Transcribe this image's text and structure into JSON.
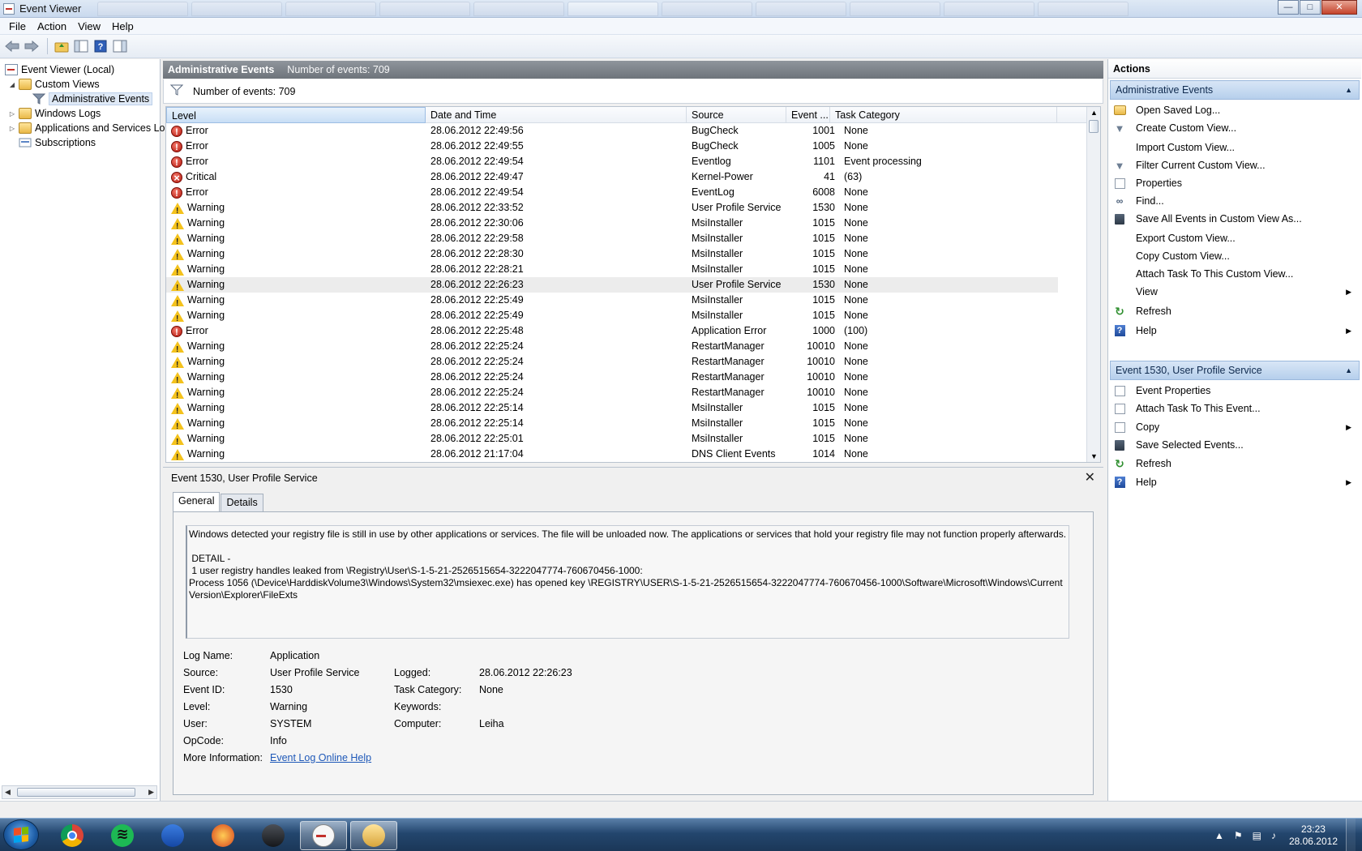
{
  "window": {
    "title": "Event Viewer"
  },
  "menu": [
    "File",
    "Action",
    "View",
    "Help"
  ],
  "toolbar": {
    "icons": [
      "back-arrow-icon",
      "forward-arrow-icon",
      "folder-up-icon",
      "show-hide-tree-icon",
      "help-icon",
      "show-hide-action-pane-icon"
    ]
  },
  "tree": {
    "root": "Event Viewer (Local)",
    "custom_views": "Custom Views",
    "admin_events": "Administrative Events",
    "windows_logs": "Windows Logs",
    "apps_services": "Applications and Services Lo",
    "subscriptions": "Subscriptions"
  },
  "middle": {
    "header_title": "Administrative Events",
    "header_count": "Number of events: 709",
    "filter_text": "Number of events: 709",
    "columns": [
      "Level",
      "Date and Time",
      "Source",
      "Event ...",
      "Task Category"
    ],
    "rows": [
      {
        "level": "Error",
        "icon": "error",
        "date": "28.06.2012 22:49:56",
        "source": "BugCheck",
        "id": "1001",
        "task": "None"
      },
      {
        "level": "Error",
        "icon": "error",
        "date": "28.06.2012 22:49:55",
        "source": "BugCheck",
        "id": "1005",
        "task": "None"
      },
      {
        "level": "Error",
        "icon": "error",
        "date": "28.06.2012 22:49:54",
        "source": "Eventlog",
        "id": "1101",
        "task": "Event processing"
      },
      {
        "level": "Critical",
        "icon": "critical",
        "date": "28.06.2012 22:49:47",
        "source": "Kernel-Power",
        "id": "41",
        "task": "(63)"
      },
      {
        "level": "Error",
        "icon": "error",
        "date": "28.06.2012 22:49:54",
        "source": "EventLog",
        "id": "6008",
        "task": "None"
      },
      {
        "level": "Warning",
        "icon": "warning",
        "date": "28.06.2012 22:33:52",
        "source": "User Profile Service",
        "id": "1530",
        "task": "None"
      },
      {
        "level": "Warning",
        "icon": "warning",
        "date": "28.06.2012 22:30:06",
        "source": "MsiInstaller",
        "id": "1015",
        "task": "None"
      },
      {
        "level": "Warning",
        "icon": "warning",
        "date": "28.06.2012 22:29:58",
        "source": "MsiInstaller",
        "id": "1015",
        "task": "None"
      },
      {
        "level": "Warning",
        "icon": "warning",
        "date": "28.06.2012 22:28:30",
        "source": "MsiInstaller",
        "id": "1015",
        "task": "None"
      },
      {
        "level": "Warning",
        "icon": "warning",
        "date": "28.06.2012 22:28:21",
        "source": "MsiInstaller",
        "id": "1015",
        "task": "None"
      },
      {
        "level": "Warning",
        "icon": "warning",
        "date": "28.06.2012 22:26:23",
        "source": "User Profile Service",
        "id": "1530",
        "task": "None"
      },
      {
        "level": "Warning",
        "icon": "warning",
        "date": "28.06.2012 22:25:49",
        "source": "MsiInstaller",
        "id": "1015",
        "task": "None"
      },
      {
        "level": "Warning",
        "icon": "warning",
        "date": "28.06.2012 22:25:49",
        "source": "MsiInstaller",
        "id": "1015",
        "task": "None"
      },
      {
        "level": "Error",
        "icon": "error",
        "date": "28.06.2012 22:25:48",
        "source": "Application Error",
        "id": "1000",
        "task": "(100)"
      },
      {
        "level": "Warning",
        "icon": "warning",
        "date": "28.06.2012 22:25:24",
        "source": "RestartManager",
        "id": "10010",
        "task": "None"
      },
      {
        "level": "Warning",
        "icon": "warning",
        "date": "28.06.2012 22:25:24",
        "source": "RestartManager",
        "id": "10010",
        "task": "None"
      },
      {
        "level": "Warning",
        "icon": "warning",
        "date": "28.06.2012 22:25:24",
        "source": "RestartManager",
        "id": "10010",
        "task": "None"
      },
      {
        "level": "Warning",
        "icon": "warning",
        "date": "28.06.2012 22:25:24",
        "source": "RestartManager",
        "id": "10010",
        "task": "None"
      },
      {
        "level": "Warning",
        "icon": "warning",
        "date": "28.06.2012 22:25:14",
        "source": "MsiInstaller",
        "id": "1015",
        "task": "None"
      },
      {
        "level": "Warning",
        "icon": "warning",
        "date": "28.06.2012 22:25:14",
        "source": "MsiInstaller",
        "id": "1015",
        "task": "None"
      },
      {
        "level": "Warning",
        "icon": "warning",
        "date": "28.06.2012 22:25:01",
        "source": "MsiInstaller",
        "id": "1015",
        "task": "None"
      },
      {
        "level": "Warning",
        "icon": "warning",
        "date": "28.06.2012 21:17:04",
        "source": "DNS Client Events",
        "id": "1014",
        "task": "None"
      }
    ],
    "highlighted_row": 10
  },
  "detail": {
    "title": "Event 1530, User Profile Service",
    "close_label": "✕",
    "tabs": [
      "General",
      "Details"
    ],
    "message": "Windows detected your registry file is still in use by other applications or services. The file will be unloaded now. The applications or services that hold your registry file may not function properly afterwards.\n\n DETAIL - \n 1 user registry handles leaked from \\Registry\\User\\S-1-5-21-2526515654-3222047774-760670456-1000:\nProcess 1056 (\\Device\\HarddiskVolume3\\Windows\\System32\\msiexec.exe) has opened key \\REGISTRY\\USER\\S-1-5-21-2526515654-3222047774-760670456-1000\\Software\\Microsoft\\Windows\\CurrentVersion\\Explorer\\FileExts",
    "labels": {
      "log_name": "Log Name:",
      "source": "Source:",
      "event_id": "Event ID:",
      "level": "Level:",
      "user": "User:",
      "opcode": "OpCode:",
      "more_info": "More Information:",
      "logged": "Logged:",
      "task_category": "Task Category:",
      "keywords": "Keywords:",
      "computer": "Computer:"
    },
    "values": {
      "log_name": "Application",
      "source": "User Profile Service",
      "event_id": "1530",
      "level": "Warning",
      "user": "SYSTEM",
      "opcode": "Info",
      "logged": "28.06.2012 22:26:23",
      "task_category": "None",
      "keywords": "",
      "computer": "Leiha",
      "more_info_link": "Event Log Online Help"
    }
  },
  "actions": {
    "header": "Actions",
    "section1": "Administrative Events",
    "section1_items": [
      {
        "label": "Open Saved Log...",
        "icon": "open-folder-icon"
      },
      {
        "label": "Create Custom View...",
        "icon": "funnel-icon"
      },
      {
        "label": "Import Custom View...",
        "icon": ""
      },
      {
        "label": "Filter Current Custom View...",
        "icon": "funnel-icon"
      },
      {
        "label": "Properties",
        "icon": "properties-icon"
      },
      {
        "label": "Find...",
        "icon": "binoculars-icon"
      },
      {
        "label": "Save All Events in Custom View As...",
        "icon": "save-disk-icon"
      },
      {
        "label": "Export Custom View...",
        "icon": ""
      },
      {
        "label": "Copy Custom View...",
        "icon": ""
      },
      {
        "label": "Attach Task To This Custom View...",
        "icon": ""
      },
      {
        "label": "View",
        "icon": "",
        "submenu": true
      },
      {
        "label": "Refresh",
        "icon": "refresh-icon"
      },
      {
        "label": "Help",
        "icon": "help-icon",
        "submenu": true
      }
    ],
    "section2": "Event 1530, User Profile Service",
    "section2_items": [
      {
        "label": "Event Properties",
        "icon": "properties-icon"
      },
      {
        "label": "Attach Task To This Event...",
        "icon": "task-icon"
      },
      {
        "label": "Copy",
        "icon": "copy-icon",
        "submenu": true
      },
      {
        "label": "Save Selected Events...",
        "icon": "save-disk-icon"
      },
      {
        "label": "Refresh",
        "icon": "refresh-icon"
      },
      {
        "label": "Help",
        "icon": "help-icon",
        "submenu": true
      }
    ]
  },
  "taskbar": {
    "apps": [
      "chrome-icon",
      "spotify-icon",
      "blue-app-icon",
      "red-app-icon",
      "playstation-icon",
      "event-viewer-icon",
      "explorer-icon"
    ],
    "clock_time": "23:23",
    "clock_date": "28.06.2012"
  }
}
